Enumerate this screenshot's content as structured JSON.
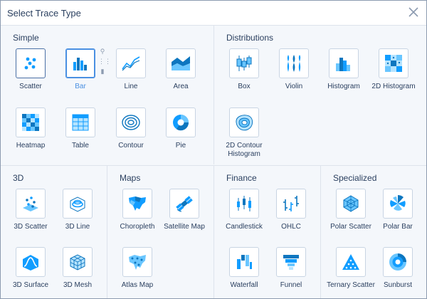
{
  "dialog": {
    "title": "Select Trace Type",
    "close_icon": "close-icon"
  },
  "sections": {
    "simple": {
      "title": "Simple",
      "items": [
        {
          "label": "Scatter",
          "icon": "scatter-icon",
          "selected": false
        },
        {
          "label": "Bar",
          "icon": "bar-icon",
          "selected": true
        },
        {
          "label": "Line",
          "icon": "line-icon",
          "selected": false
        },
        {
          "label": "Area",
          "icon": "area-icon",
          "selected": false
        },
        {
          "label": "Heatmap",
          "icon": "heatmap-icon",
          "selected": false
        },
        {
          "label": "Table",
          "icon": "table-icon",
          "selected": false
        },
        {
          "label": "Contour",
          "icon": "contour-icon",
          "selected": false
        },
        {
          "label": "Pie",
          "icon": "pie-icon",
          "selected": false
        }
      ]
    },
    "distributions": {
      "title": "Distributions",
      "items": [
        {
          "label": "Box",
          "icon": "box-plot-icon"
        },
        {
          "label": "Violin",
          "icon": "violin-icon"
        },
        {
          "label": "Histogram",
          "icon": "histogram-icon"
        },
        {
          "label": "2D Histogram",
          "icon": "histogram-2d-icon"
        },
        {
          "label": "2D Contour Histogram",
          "icon": "contour-histogram-icon"
        }
      ]
    },
    "three_d": {
      "title": "3D",
      "items": [
        {
          "label": "3D Scatter",
          "icon": "scatter-3d-icon"
        },
        {
          "label": "3D Line",
          "icon": "line-3d-icon"
        },
        {
          "label": "3D Surface",
          "icon": "surface-3d-icon"
        },
        {
          "label": "3D Mesh",
          "icon": "mesh-3d-icon"
        }
      ]
    },
    "maps": {
      "title": "Maps",
      "items": [
        {
          "label": "Choropleth",
          "icon": "choropleth-icon"
        },
        {
          "label": "Satellite Map",
          "icon": "satellite-icon"
        },
        {
          "label": "Atlas Map",
          "icon": "atlas-map-icon"
        }
      ]
    },
    "finance": {
      "title": "Finance",
      "items": [
        {
          "label": "Candlestick",
          "icon": "candlestick-icon"
        },
        {
          "label": "OHLC",
          "icon": "ohlc-icon"
        },
        {
          "label": "Waterfall",
          "icon": "waterfall-icon"
        },
        {
          "label": "Funnel",
          "icon": "funnel-icon"
        }
      ]
    },
    "specialized": {
      "title": "Specialized",
      "items": [
        {
          "label": "Polar Scatter",
          "icon": "polar-scatter-icon"
        },
        {
          "label": "Polar Bar",
          "icon": "polar-bar-icon"
        },
        {
          "label": "Ternary Scatter",
          "icon": "ternary-scatter-icon"
        },
        {
          "label": "Sunburst",
          "icon": "sunburst-icon"
        }
      ]
    }
  },
  "bar_hover_actions": [
    {
      "icon": "search-icon",
      "glyph": "⚲"
    },
    {
      "icon": "grid-icon",
      "glyph": "⋮⋮"
    },
    {
      "icon": "chart-icon",
      "glyph": "▮"
    }
  ],
  "colors": {
    "accent": "#4a90e2",
    "icon_blue": "#119dff",
    "icon_dark": "#0d76bf",
    "text": "#2a3f5f",
    "border": "#c8d4e3"
  }
}
